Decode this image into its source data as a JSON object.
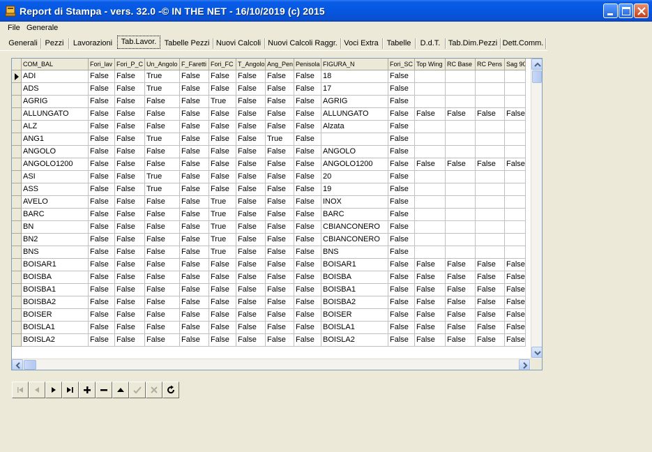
{
  "window": {
    "title": "Report di Stampa - vers. 32.0 -© IN THE NET - 16/10/2019 (c) 2015",
    "buttons": [
      "minimize",
      "maximize",
      "close"
    ]
  },
  "menu": [
    "File",
    "Generale"
  ],
  "tabs": [
    {
      "label": "Generali",
      "active": false
    },
    {
      "label": "Pezzi",
      "active": false
    },
    {
      "label": "Lavorazioni",
      "active": false
    },
    {
      "label": "Tab.Lavor.",
      "active": true
    },
    {
      "label": "Tabelle Pezzi",
      "active": false
    },
    {
      "label": "Nuovi Calcoli",
      "active": false
    },
    {
      "label": "Nuovi Calcoli Raggr.",
      "active": false
    },
    {
      "label": "Voci Extra",
      "active": false
    },
    {
      "label": "Tabelle",
      "active": false
    },
    {
      "label": "D.d.T.",
      "active": false
    },
    {
      "label": "Tab.Dim.Pezzi",
      "active": false
    },
    {
      "label": "Dett.Comm.",
      "active": false
    }
  ],
  "grid": {
    "columns": [
      "COM_BAL",
      "Fori_lav",
      "Fori_P_C",
      "Un_Angolo",
      "F_Faretti",
      "Fori_FC",
      "T_Angolo",
      "Ang_Pen",
      "Penisola",
      "FIGURA_N",
      "Fori_SC",
      "Top Wing",
      "RC Base",
      "RC Pens",
      "Sag 90"
    ],
    "current_row": 0,
    "rows": [
      [
        "ADI",
        "False",
        "False",
        "True",
        "False",
        "False",
        "False",
        "False",
        "False",
        "18",
        "False",
        "",
        "",
        "",
        ""
      ],
      [
        "ADS",
        "False",
        "False",
        "True",
        "False",
        "False",
        "False",
        "False",
        "False",
        "17",
        "False",
        "",
        "",
        "",
        ""
      ],
      [
        "AGRIG",
        "False",
        "False",
        "False",
        "False",
        "True",
        "False",
        "False",
        "False",
        "AGRIG",
        "False",
        "",
        "",
        "",
        ""
      ],
      [
        "ALLUNGATO",
        "False",
        "False",
        "False",
        "False",
        "False",
        "False",
        "False",
        "False",
        "ALLUNGATO",
        "False",
        "False",
        "False",
        "False",
        "False"
      ],
      [
        "ALZ",
        "False",
        "False",
        "False",
        "False",
        "False",
        "False",
        "False",
        "False",
        "Alzata",
        "False",
        "",
        "",
        "",
        ""
      ],
      [
        "ANG1",
        "False",
        "False",
        "True",
        "False",
        "False",
        "False",
        "True",
        "False",
        "",
        "False",
        "",
        "",
        "",
        ""
      ],
      [
        "ANGOLO",
        "False",
        "False",
        "False",
        "False",
        "False",
        "False",
        "False",
        "False",
        "ANGOLO",
        "False",
        "",
        "",
        "",
        ""
      ],
      [
        "ANGOLO1200",
        "False",
        "False",
        "False",
        "False",
        "False",
        "False",
        "False",
        "False",
        "ANGOLO1200",
        "False",
        "False",
        "False",
        "False",
        "False"
      ],
      [
        "ASI",
        "False",
        "False",
        "True",
        "False",
        "False",
        "False",
        "False",
        "False",
        "20",
        "False",
        "",
        "",
        "",
        ""
      ],
      [
        "ASS",
        "False",
        "False",
        "True",
        "False",
        "False",
        "False",
        "False",
        "False",
        "19",
        "False",
        "",
        "",
        "",
        ""
      ],
      [
        "AVELO",
        "False",
        "False",
        "False",
        "False",
        "True",
        "False",
        "False",
        "False",
        "INOX",
        "False",
        "",
        "",
        "",
        ""
      ],
      [
        "BARC",
        "False",
        "False",
        "False",
        "False",
        "True",
        "False",
        "False",
        "False",
        "BARC",
        "False",
        "",
        "",
        "",
        ""
      ],
      [
        "BN",
        "False",
        "False",
        "False",
        "False",
        "True",
        "False",
        "False",
        "False",
        "CBIANCONERO",
        "False",
        "",
        "",
        "",
        ""
      ],
      [
        "BN2",
        "False",
        "False",
        "False",
        "False",
        "True",
        "False",
        "False",
        "False",
        "CBIANCONERO",
        "False",
        "",
        "",
        "",
        ""
      ],
      [
        "BNS",
        "False",
        "False",
        "False",
        "False",
        "True",
        "False",
        "False",
        "False",
        "BNS",
        "False",
        "",
        "",
        "",
        ""
      ],
      [
        "BOISAR1",
        "False",
        "False",
        "False",
        "False",
        "False",
        "False",
        "False",
        "False",
        "BOISAR1",
        "False",
        "False",
        "False",
        "False",
        "False"
      ],
      [
        "BOISBA",
        "False",
        "False",
        "False",
        "False",
        "False",
        "False",
        "False",
        "False",
        "BOISBA",
        "False",
        "False",
        "False",
        "False",
        "False"
      ],
      [
        "BOISBA1",
        "False",
        "False",
        "False",
        "False",
        "False",
        "False",
        "False",
        "False",
        "BOISBA1",
        "False",
        "False",
        "False",
        "False",
        "False"
      ],
      [
        "BOISBA2",
        "False",
        "False",
        "False",
        "False",
        "False",
        "False",
        "False",
        "False",
        "BOISBA2",
        "False",
        "False",
        "False",
        "False",
        "False"
      ],
      [
        "BOISER",
        "False",
        "False",
        "False",
        "False",
        "False",
        "False",
        "False",
        "False",
        "BOISER",
        "False",
        "False",
        "False",
        "False",
        "False"
      ],
      [
        "BOISLA1",
        "False",
        "False",
        "False",
        "False",
        "False",
        "False",
        "False",
        "False",
        "BOISLA1",
        "False",
        "False",
        "False",
        "False",
        "False"
      ],
      [
        "BOISLA2",
        "False",
        "False",
        "False",
        "False",
        "False",
        "False",
        "False",
        "False",
        "BOISLA2",
        "False",
        "False",
        "False",
        "False",
        "False"
      ]
    ]
  },
  "navigator": {
    "buttons": [
      {
        "name": "first-record",
        "enabled": false
      },
      {
        "name": "prior-record",
        "enabled": false
      },
      {
        "name": "next-record",
        "enabled": true
      },
      {
        "name": "last-record",
        "enabled": true
      },
      {
        "name": "insert-record",
        "enabled": true
      },
      {
        "name": "delete-record",
        "enabled": true
      },
      {
        "name": "edit-record",
        "enabled": true
      },
      {
        "name": "post-edit",
        "enabled": false
      },
      {
        "name": "cancel-edit",
        "enabled": false
      },
      {
        "name": "refresh-data",
        "enabled": true
      }
    ]
  }
}
